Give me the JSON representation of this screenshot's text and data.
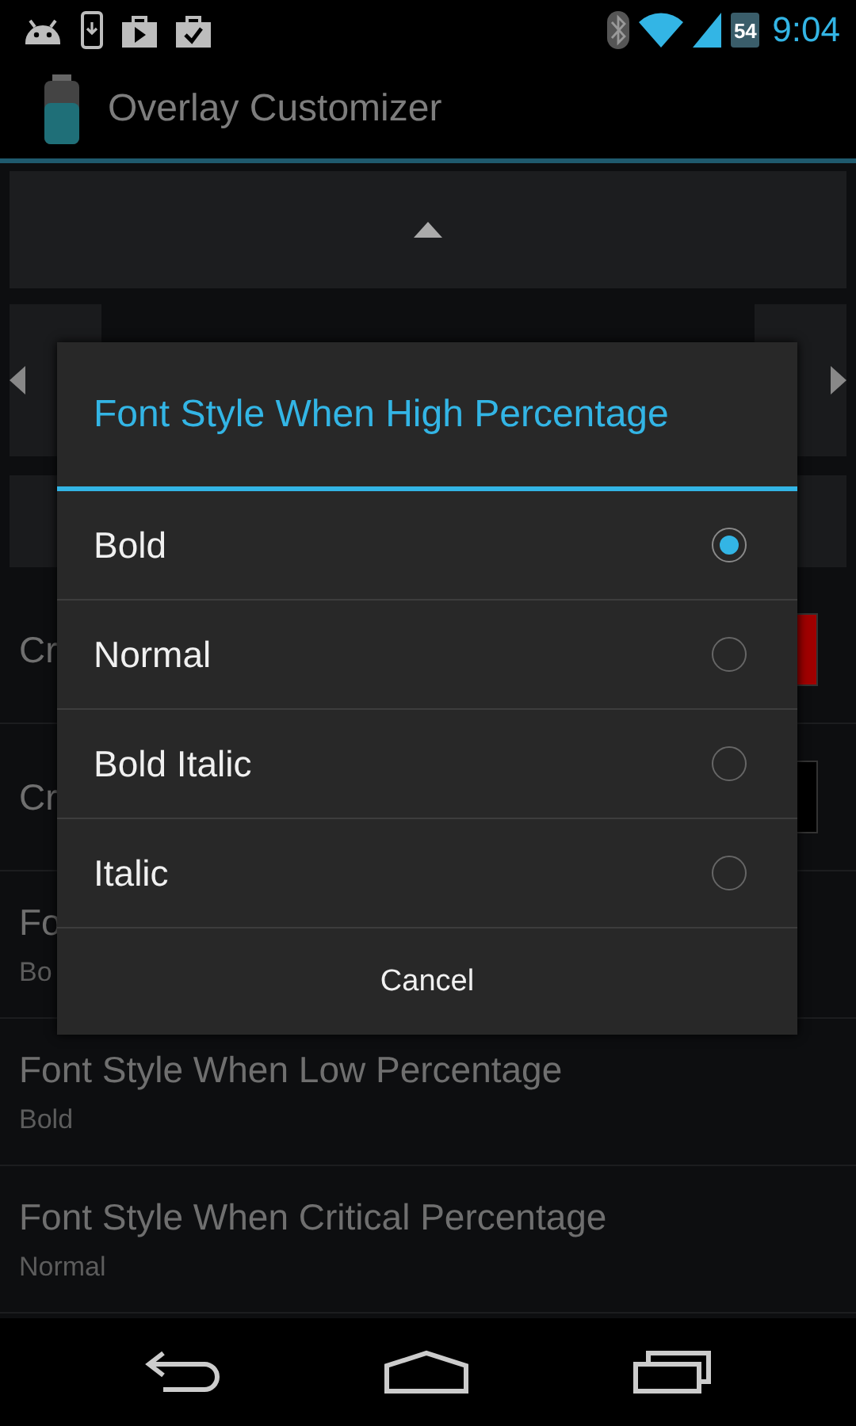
{
  "status_bar": {
    "battery": "54",
    "time": "9:04"
  },
  "action_bar": {
    "title": "Overlay Customizer"
  },
  "rows": [
    {
      "kind": "color",
      "title": "Cr",
      "color": "#a00000"
    },
    {
      "kind": "color",
      "title": "Cr",
      "color": "#000000"
    },
    {
      "kind": "list",
      "title": "Fo",
      "summary": "Bo"
    },
    {
      "kind": "list",
      "title": "Font Style When Low Percentage",
      "summary": "Bold"
    },
    {
      "kind": "list",
      "title": "Font Style When Critical Percentage",
      "summary": "Normal"
    }
  ],
  "dialog": {
    "title": "Font Style When High Percentage",
    "options": [
      {
        "label": "Bold",
        "selected": true
      },
      {
        "label": "Normal",
        "selected": false
      },
      {
        "label": "Bold Italic",
        "selected": false
      },
      {
        "label": "Italic",
        "selected": false
      }
    ],
    "cancel": "Cancel"
  }
}
